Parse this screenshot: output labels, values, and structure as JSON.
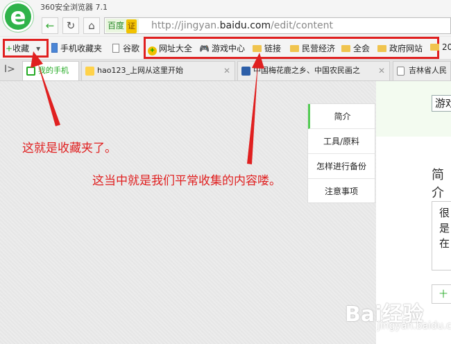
{
  "browser": {
    "title": "360安全浏览器 7.1",
    "search_engine": "百度",
    "cert_badge": "证",
    "url_prefix": "http://jingyan.",
    "url_domain": "baidu.com",
    "url_path": "/edit/content"
  },
  "bookmarks": {
    "favorites": "收藏",
    "items": [
      "手机收藏夹",
      "谷歌"
    ],
    "folder_items": [
      "网址大全",
      "游戏中心",
      "链接",
      "民营经济",
      "全会",
      "政府网站",
      "20"
    ]
  },
  "tabs": [
    {
      "label": "我的手机"
    },
    {
      "label": "hao123_上网从这里开始"
    },
    {
      "label": "中国梅花鹿之乡、中国农民画之"
    },
    {
      "label": "吉林省人民"
    }
  ],
  "page": {
    "toc": [
      "简介",
      "工具/原料",
      "怎样进行备份",
      "注意事项"
    ],
    "search_stub": "游戏",
    "intro_heading": "简介",
    "intro_lines": [
      "很",
      "是",
      "在"
    ],
    "button_stub": "十"
  },
  "annotations": {
    "left": "这就是收藏夹了。",
    "middle": "这当中就是我们平常收集的内容喽。"
  },
  "watermark": {
    "main": "Bai经验",
    "sub": "jingyan.baidu.com"
  },
  "colors": {
    "accent_green": "#2fb34a",
    "annotation_red": "#e02020"
  }
}
